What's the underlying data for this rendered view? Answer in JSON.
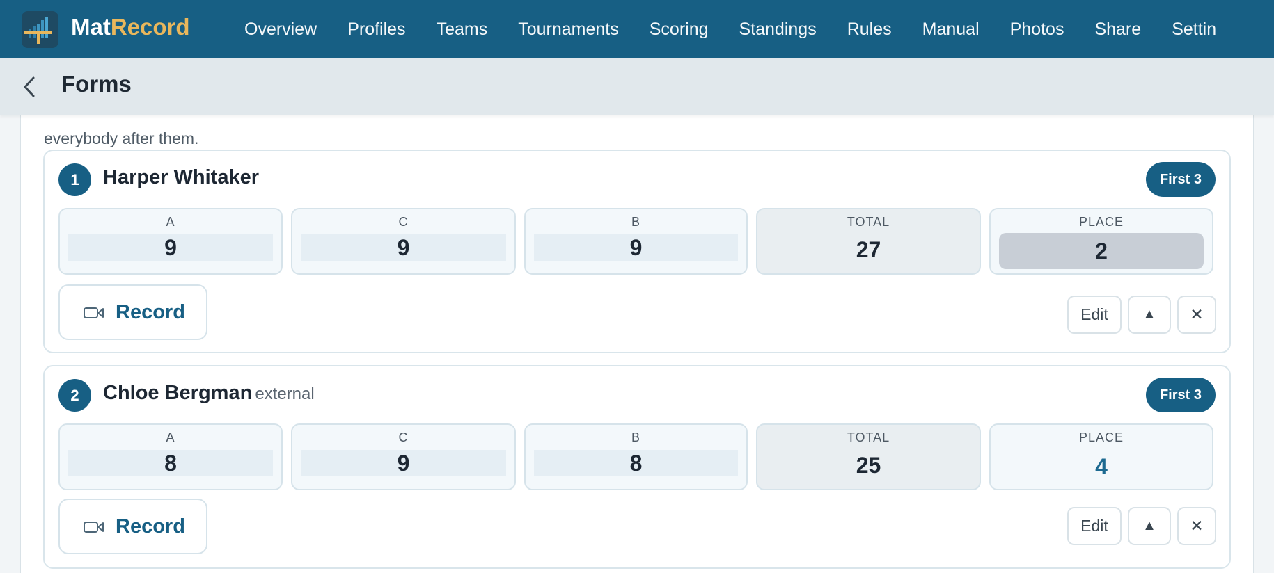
{
  "app": {
    "brand_part1": "Mat",
    "brand_part2": "Record",
    "nav": [
      "Overview",
      "Profiles",
      "Teams",
      "Tournaments",
      "Scoring",
      "Standings",
      "Rules",
      "Manual",
      "Photos",
      "Share",
      "Settin"
    ]
  },
  "page": {
    "title": "Forms",
    "intro": "everybody after them."
  },
  "entries": [
    {
      "number": "1",
      "name": "Harper Whitaker",
      "tag": "",
      "pill": "First 3",
      "scores": [
        {
          "label": "A",
          "value": "9"
        },
        {
          "label": "C",
          "value": "9"
        },
        {
          "label": "B",
          "value": "9"
        }
      ],
      "total_label": "TOTAL",
      "total": "27",
      "place_label": "PLACE",
      "place": "2",
      "record_label": "Record",
      "edit_label": "Edit",
      "up_label": "▲",
      "close_label": "✕"
    },
    {
      "number": "2",
      "name": "Chloe Bergman",
      "tag": "external",
      "pill": "First 3",
      "scores": [
        {
          "label": "A",
          "value": "8"
        },
        {
          "label": "C",
          "value": "9"
        },
        {
          "label": "B",
          "value": "8"
        }
      ],
      "total_label": "TOTAL",
      "total": "25",
      "place_label": "PLACE",
      "place": "4",
      "record_label": "Record",
      "edit_label": "Edit",
      "up_label": "▲",
      "close_label": "✕"
    }
  ],
  "colors": {
    "primary": "#175f84",
    "accent": "#e9b75c",
    "place_highlight": "#c8ced6"
  },
  "icons": {
    "logo": "podium-logo-icon",
    "back": "chevron-left-icon",
    "record": "video-camera-icon",
    "move_up": "triangle-up-icon",
    "remove": "close-icon"
  }
}
